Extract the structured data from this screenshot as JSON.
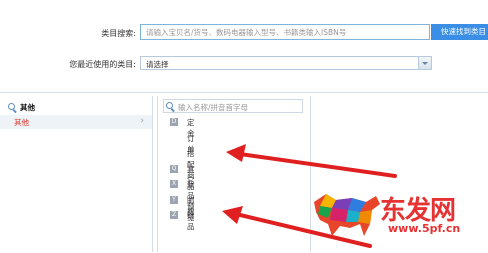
{
  "category_search": {
    "label": "类目搜索:",
    "placeholder": "请输入宝贝名/货号、数码电器输入型号、书籍类输入ISBN号",
    "button": "快速找到类目"
  },
  "recent": {
    "label": "您最近使用的类目:",
    "selected": "请选择"
  },
  "col1": {
    "search_value": "其他",
    "selected_item": "其他"
  },
  "col2": {
    "search_placeholder": "输入名称/拼音首字母",
    "items": [
      {
        "letter": "D",
        "name": "定金"
      },
      {
        "letter": "",
        "name": "订单"
      },
      {
        "letter": "",
        "name": "搭配商品"
      },
      {
        "letter": "Q",
        "name": "其它"
      },
      {
        "letter": "X",
        "name": "新品预览"
      },
      {
        "letter": "Y",
        "name": "邮费"
      },
      {
        "letter": "Z",
        "name": "赠品"
      }
    ]
  },
  "logo": {
    "text": "东发网",
    "url": "www.5pf.cn"
  },
  "colors": {
    "accent": "#3a8ee6",
    "selected_text": "#e0362b",
    "arrow": "#e02020"
  }
}
